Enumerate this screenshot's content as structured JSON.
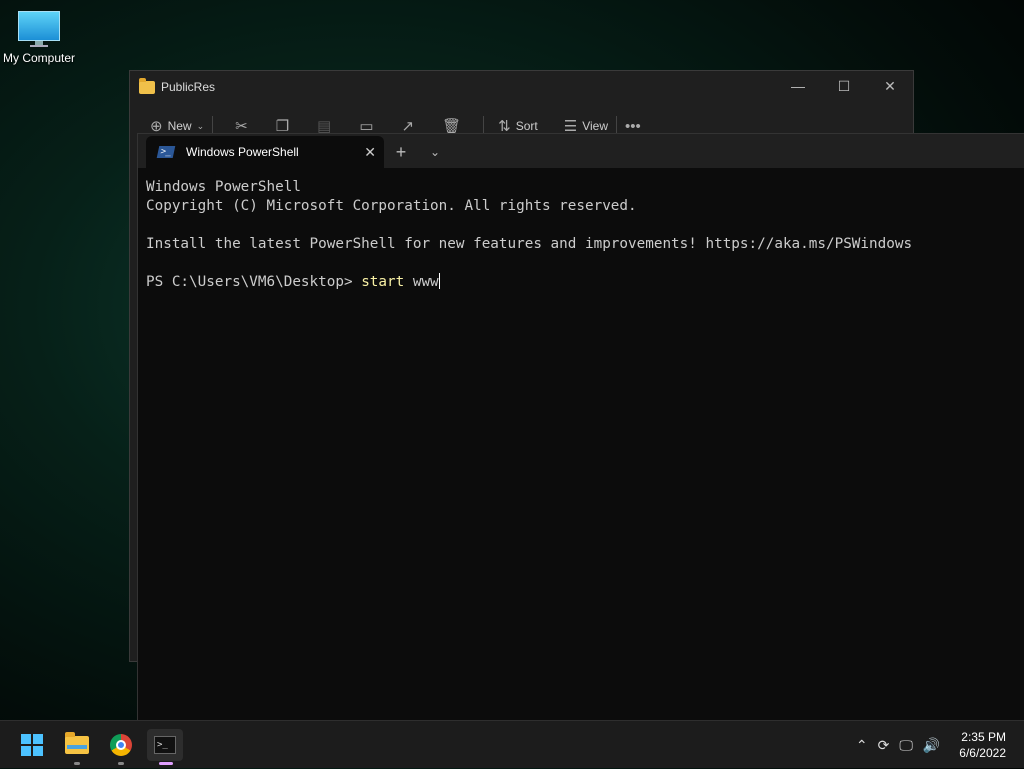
{
  "desktop": {
    "icons": [
      {
        "label": "My Computer",
        "icon": "monitor-icon"
      }
    ]
  },
  "explorer": {
    "title": "PublicRes",
    "toolbar": {
      "new_label": "New",
      "sort_label": "Sort",
      "view_label": "View",
      "more_label": "•••"
    }
  },
  "terminal": {
    "tab_title": "Windows PowerShell",
    "lines": [
      "Windows PowerShell",
      "Copyright (C) Microsoft Corporation. All rights reserved.",
      "",
      "Install the latest PowerShell for new features and improvements! https://aka.ms/PSWindows",
      ""
    ],
    "prompt": "PS C:\\Users\\VM6\\Desktop> ",
    "command": "start",
    "argument": " www"
  },
  "taskbar": {
    "apps": [
      "start-icon",
      "file-explorer-icon",
      "chrome-icon",
      "terminal-icon"
    ],
    "time": "2:35 PM",
    "date": "6/6/2022"
  },
  "colors": {
    "terminal_bg": "#0c0c0c",
    "command": "#f9f1a5",
    "accent": "#4cc2ff"
  }
}
